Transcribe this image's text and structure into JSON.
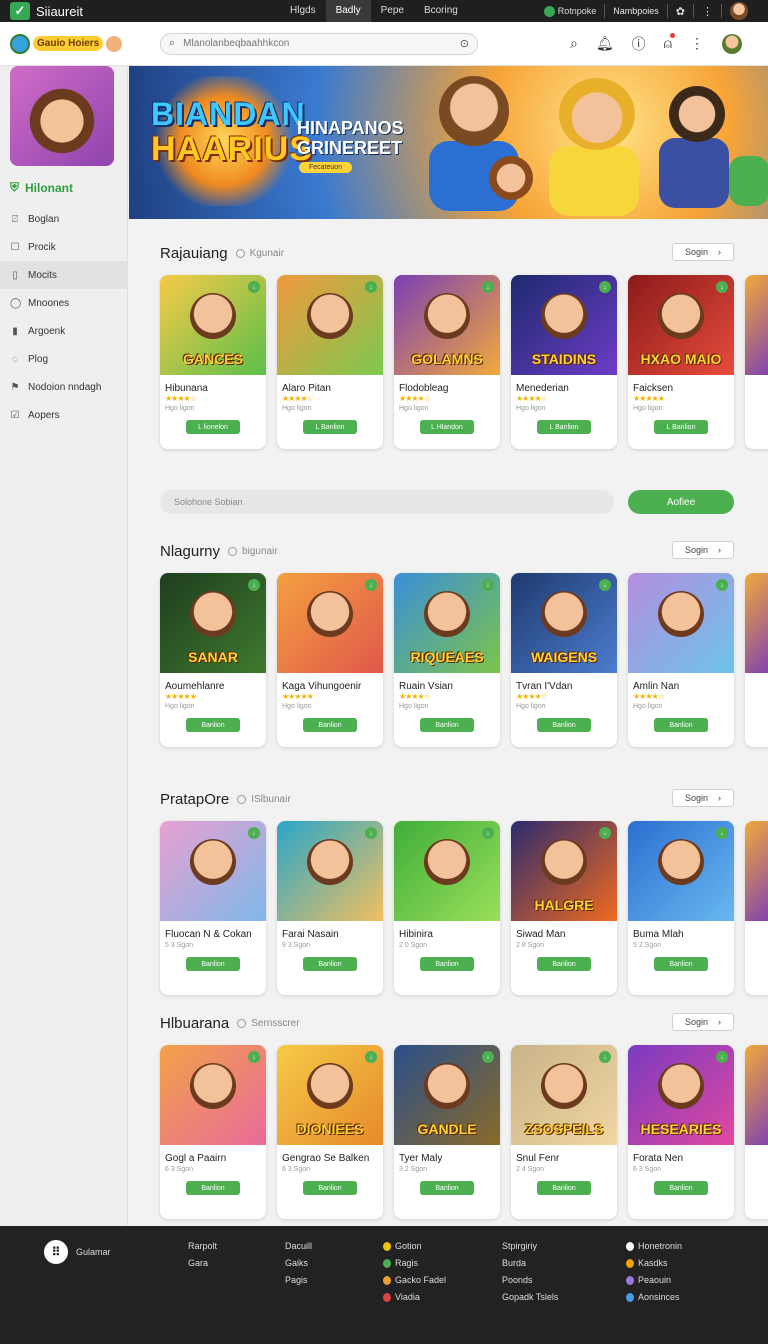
{
  "topbar": {
    "brand": "Siiaureit",
    "nav": [
      "Hlgds",
      "Badly",
      "Pepe",
      "Bcoring"
    ],
    "right_a": "Rotnpoke",
    "right_b": "Nambpoies"
  },
  "header": {
    "logo_text": "Gauio Hoiers",
    "search_placeholder": "Mlanolanbeqbaahhkcon"
  },
  "sidebar": {
    "user": "Hilonant",
    "items": [
      {
        "label": "Boglan",
        "icon": "bookmark-icon"
      },
      {
        "label": "Procik",
        "icon": "square-icon"
      },
      {
        "label": "Mocits",
        "icon": "clipboard-icon"
      },
      {
        "label": "Mnoones",
        "icon": "chat-icon"
      },
      {
        "label": "Argoenk",
        "icon": "bottle-icon"
      },
      {
        "label": "Plog",
        "icon": "pin-icon"
      },
      {
        "label": "Nodoion nndagh",
        "icon": "flag-icon"
      },
      {
        "label": "Aopers",
        "icon": "check-box-icon"
      }
    ]
  },
  "banner": {
    "title_line1": "BIANDAN",
    "title_line2": "HAARIUS",
    "subtitle_line1": "HINAPANOS",
    "subtitle_line2": "GRINEREET",
    "badge": "Fecateuon"
  },
  "sections": [
    {
      "title": "Rajauiang",
      "subtitle": "Kgunair",
      "button": "Sogin",
      "cards": [
        {
          "name": "Hibunana",
          "meta": "Hgo ligon",
          "thumb_text": "GANCES",
          "button": "L lionelon",
          "stars": "★★★★☆",
          "bg1": "#f7c948",
          "bg2": "#5cbf4a"
        },
        {
          "name": "Alaro Pitan",
          "meta": "Hgo ligon",
          "thumb_text": "",
          "button": "L Banlion",
          "stars": "★★★★☆",
          "bg1": "#f19a3e",
          "bg2": "#7ec850"
        },
        {
          "name": "Flodobleag",
          "meta": "Hgo ligon",
          "thumb_text": "GOLAMNS",
          "button": "L Hlandon",
          "stars": "★★★★☆",
          "bg1": "#7b3fb3",
          "bg2": "#f2a93b"
        },
        {
          "name": "Menederian",
          "meta": "Hgo ligon",
          "thumb_text": "STAIDINS",
          "button": "L Banlion",
          "stars": "★★★★☆",
          "bg1": "#1d2a6e",
          "bg2": "#6d3cc7"
        },
        {
          "name": "Faicksen",
          "meta": "Hgo ligon",
          "thumb_text": "HXAO MAIO",
          "button": "L Banlion",
          "stars": "★★★★★",
          "bg1": "#8b1a1a",
          "bg2": "#e74c3c"
        }
      ]
    },
    {
      "title": "Nlagurny",
      "subtitle": "bigunair",
      "button": "Sogin",
      "cards": [
        {
          "name": "Aoumehlanre",
          "meta": "Hgo ligon",
          "thumb_text": "SANAR",
          "button": "Banlion",
          "stars": "★★★★★",
          "bg1": "#1f3d1f",
          "bg2": "#3e7a2e"
        },
        {
          "name": "Kaga Vihungoenir",
          "meta": "Hgo ligon",
          "thumb_text": "",
          "button": "Banlion",
          "stars": "★★★★★",
          "bg1": "#f4a040",
          "bg2": "#e0584a"
        },
        {
          "name": "Ruain Vsian",
          "meta": "Hgo ligon",
          "thumb_text": "RIQUEAES",
          "button": "Banlion",
          "stars": "★★★★☆",
          "bg1": "#3a8fd8",
          "bg2": "#7cc44a"
        },
        {
          "name": "Tvran I'Vdan",
          "meta": "Hgo ligon",
          "thumb_text": "WAIGENS",
          "button": "Banlion",
          "stars": "★★★★☆",
          "bg1": "#1e3a6e",
          "bg2": "#4c7dd0"
        },
        {
          "name": "Amlin Nan",
          "meta": "Hgo ligon",
          "thumb_text": "",
          "button": "Banlion",
          "stars": "★★★★☆",
          "bg1": "#b58de0",
          "bg2": "#6cc4e8"
        }
      ]
    },
    {
      "title": "PratapOre",
      "subtitle": "ISlbunair",
      "button": "Sogin",
      "cards": [
        {
          "name": "Fluocan N & Cokan",
          "meta": "5 3 Sgon",
          "thumb_text": "",
          "button": "Banlion",
          "stars": "",
          "bg1": "#e8a0d0",
          "bg2": "#7fb8ea"
        },
        {
          "name": "Farai Nasain",
          "meta": "9 3 Sgon",
          "thumb_text": "",
          "button": "Banlion",
          "stars": "",
          "bg1": "#2aa6c9",
          "bg2": "#f0c060"
        },
        {
          "name": "Hibinira",
          "meta": "2 0 Sgon",
          "thumb_text": "",
          "button": "Banlion",
          "stars": "",
          "bg1": "#3fae3a",
          "bg2": "#9adf5a"
        },
        {
          "name": "Siwad Man",
          "meta": "2 8 Sgon",
          "thumb_text": "HALGRE",
          "button": "Banlion",
          "stars": "",
          "bg1": "#2b2b6e",
          "bg2": "#f06a20"
        },
        {
          "name": "Buma Mlah",
          "meta": "5 2 Sgon",
          "thumb_text": "",
          "button": "Banlion",
          "stars": "",
          "bg1": "#2b6fd0",
          "bg2": "#69b8f0"
        }
      ]
    },
    {
      "title": "Hlbuarana",
      "subtitle": "Sernsscrer",
      "button": "Sogin",
      "cards": [
        {
          "name": "Gogl a Paairn",
          "meta": "6 3 Sgon",
          "thumb_text": "",
          "button": "Banlion",
          "stars": "",
          "bg1": "#f2a24a",
          "bg2": "#e86a9a"
        },
        {
          "name": "Gengrao Se Balken",
          "meta": "6 3 Sgon",
          "thumb_text": "DIONIEES",
          "button": "Banlion",
          "stars": "",
          "bg1": "#f7c948",
          "bg2": "#e58a2a"
        },
        {
          "name": "Tyer Maly",
          "meta": "3 2 Sgon",
          "thumb_text": "GANDLE",
          "button": "Banlion",
          "stars": "",
          "bg1": "#2a4f8a",
          "bg2": "#8a6a2a"
        },
        {
          "name": "Snul Fenr",
          "meta": "2 4 Sgon",
          "thumb_text": "ZSOSPEILS",
          "button": "Banlion",
          "stars": "",
          "bg1": "#c9b38a",
          "bg2": "#f0d6a0"
        },
        {
          "name": "Forata Nen",
          "meta": "6 3 Sgon",
          "thumb_text": "HESEARIES",
          "button": "Banlion",
          "stars": "",
          "bg1": "#7a3bc0",
          "bg2": "#e048a0"
        }
      ]
    }
  ],
  "promo": {
    "placeholder": "Solohone Sobian",
    "button": "Aofiee"
  },
  "footer": {
    "brand": "Gulamar",
    "col1": [
      "Rarpolt",
      "Gara",
      ""
    ],
    "col2": [
      "Dacuill",
      "Gaiks",
      "Pagis"
    ],
    "col3": [
      "Gotion",
      "Ragis",
      "Gacko Fadel",
      "Viadia"
    ],
    "col4": [
      "Stpirgiriy",
      "Burda",
      "Poonds",
      "Gopadk Tslels"
    ],
    "col5": [
      "Honetronin",
      "Kasdks",
      "Peaouin",
      "Aonsinces"
    ]
  },
  "colors": {
    "accent": "#4caf50",
    "topbar": "#1f1f1f",
    "footer": "#222222"
  }
}
